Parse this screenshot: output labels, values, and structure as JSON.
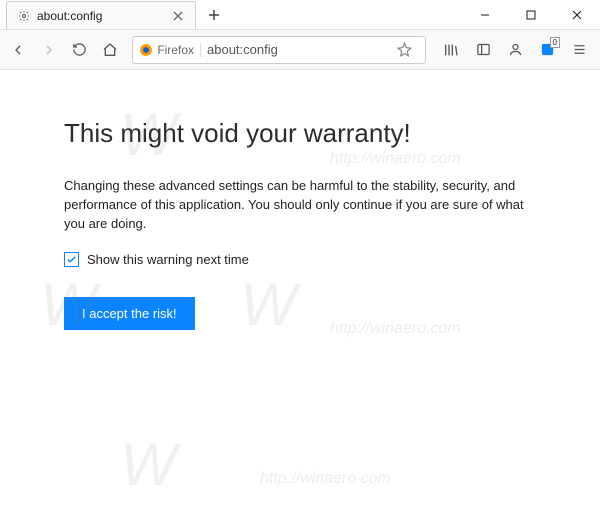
{
  "window": {
    "tab_label": "about:config",
    "identity_label": "Firefox",
    "url": "about:config"
  },
  "warning": {
    "heading": "This might void your warranty!",
    "body": "Changing these advanced settings can be harmful to the stability, security, and performance of this application. You should only continue if you are sure of what you are doing.",
    "checkbox_label": "Show this warning next time",
    "button_label": "I accept the risk!"
  },
  "watermark": {
    "text": "http://winaero.com"
  }
}
